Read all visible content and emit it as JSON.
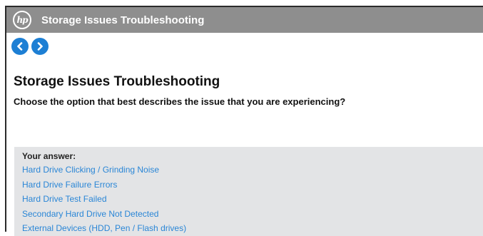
{
  "window": {
    "logo_text": "hp",
    "title": "Storage Issues Troubleshooting"
  },
  "nav": {
    "back_icon": "chevron-left-icon",
    "forward_icon": "chevron-right-icon"
  },
  "main": {
    "heading": "Storage Issues Troubleshooting",
    "question": "Choose the option that best describes the issue that you are experiencing?"
  },
  "answers": {
    "label": "Your answer:",
    "options": [
      "Hard Drive Clicking / Grinding Noise",
      "Hard Drive Failure Errors",
      "Hard Drive Test Failed",
      "Secondary Hard Drive Not Detected",
      "External Devices (HDD, Pen / Flash drives)"
    ]
  },
  "colors": {
    "titlebar": "#8e8e8e",
    "nav_button": "#1d7fd4",
    "link": "#2a86d6",
    "answer_panel": "#e3e4e6"
  }
}
